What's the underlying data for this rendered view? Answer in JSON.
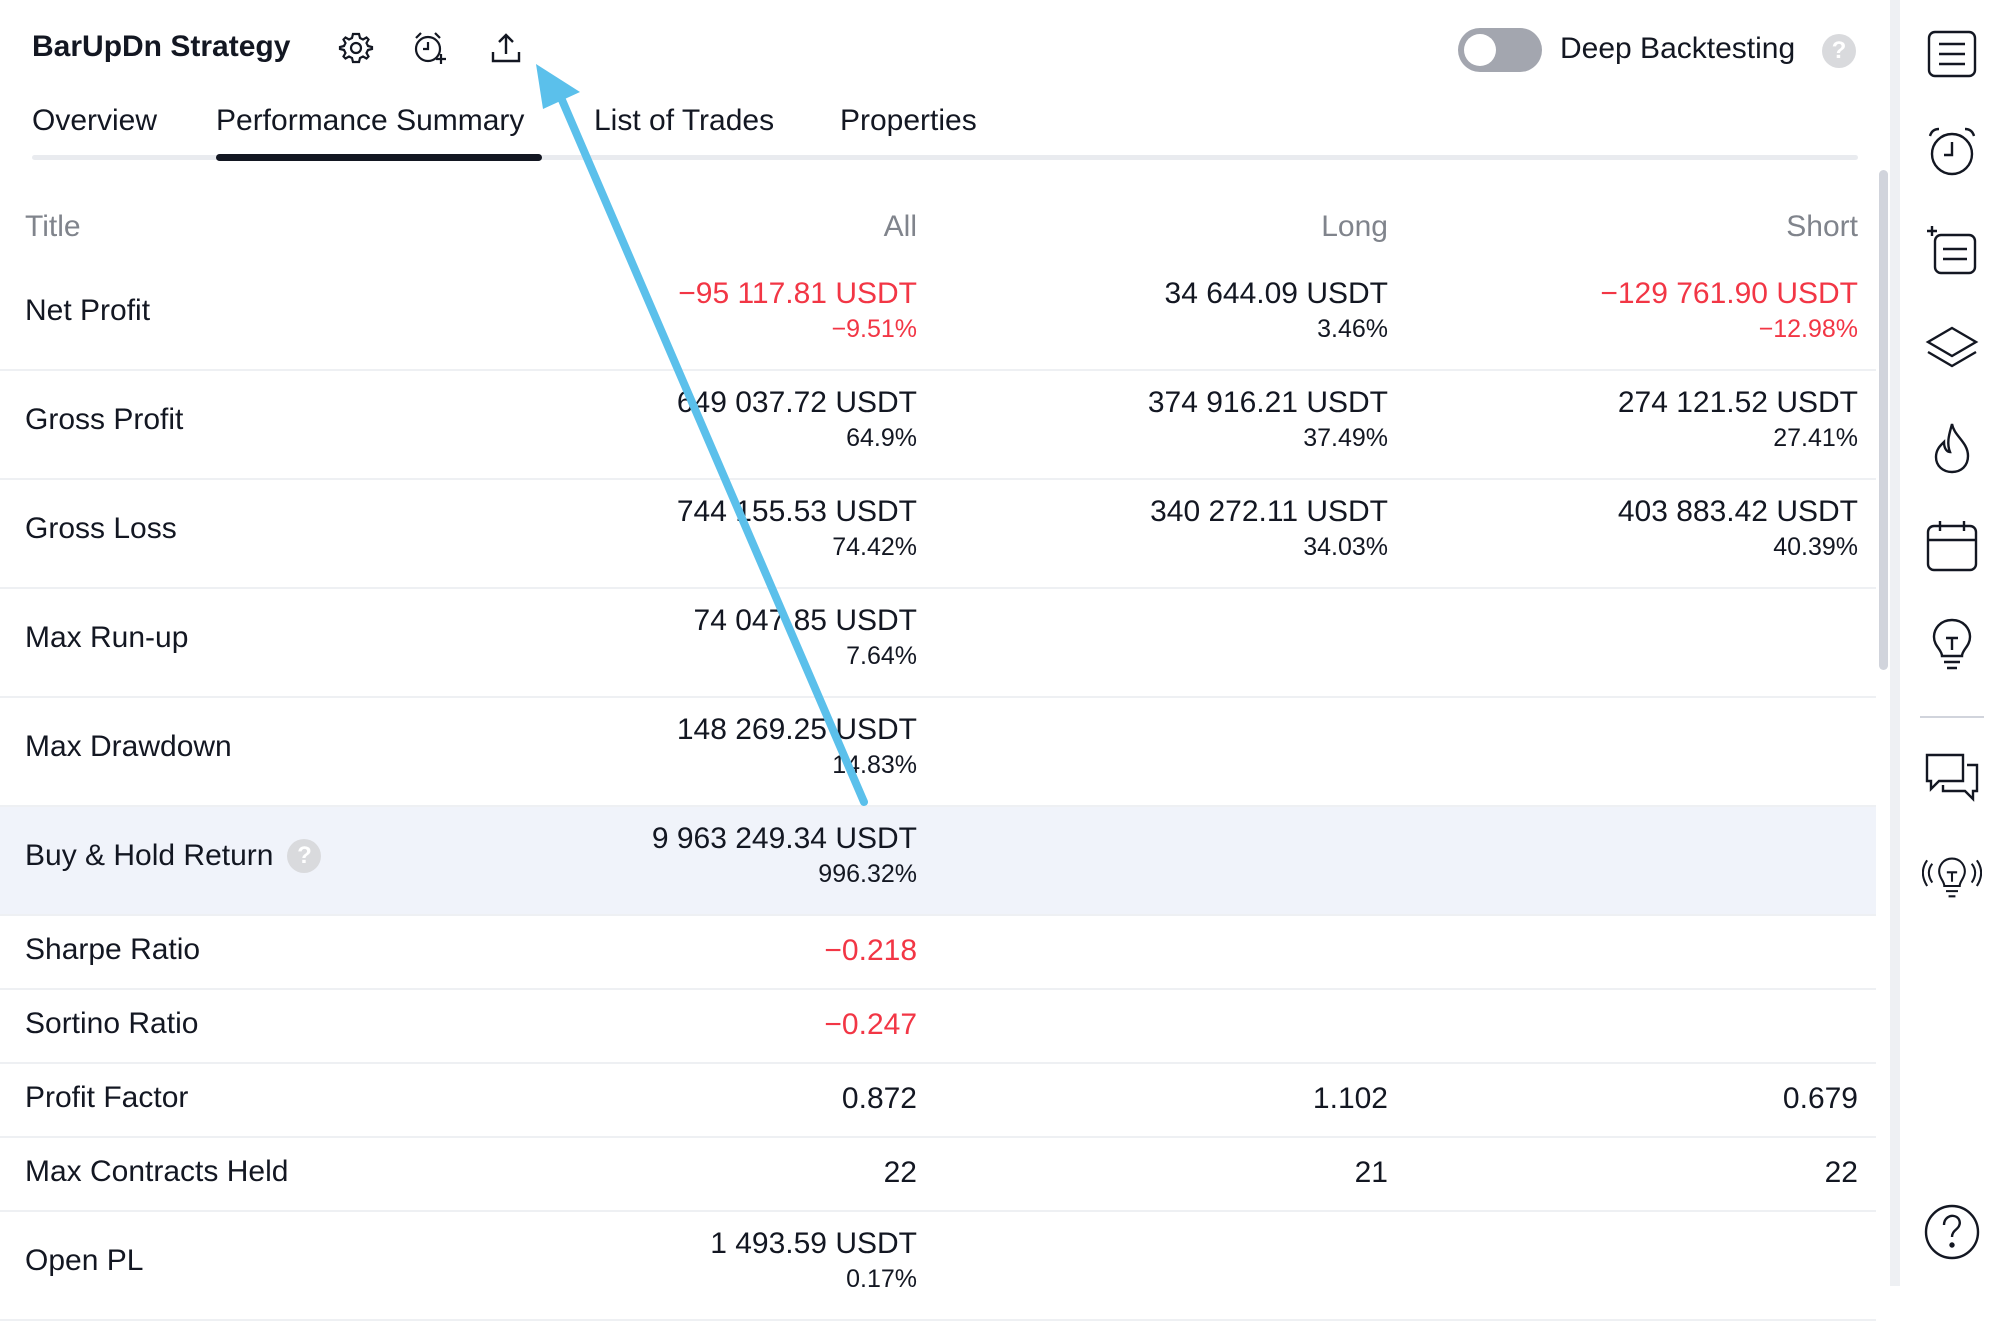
{
  "header": {
    "title": "BarUpDn Strategy",
    "icons": [
      "gear-icon",
      "add-alert-icon",
      "export-icon"
    ],
    "deep_backtesting_label": "Deep Backtesting",
    "deep_backtesting_on": false,
    "help_glyph": "?"
  },
  "tabs": [
    {
      "label": "Overview",
      "active": false
    },
    {
      "label": "Performance Summary",
      "active": true
    },
    {
      "label": "List of Trades",
      "active": false
    },
    {
      "label": "Properties",
      "active": false
    }
  ],
  "table": {
    "columns": [
      "Title",
      "All",
      "Long",
      "Short"
    ],
    "rows": [
      {
        "title": "Net Profit",
        "all": {
          "value": "−95 117.81 USDT",
          "pct": "−9.51%",
          "neg": true
        },
        "long": {
          "value": "34 644.09 USDT",
          "pct": "3.46%"
        },
        "short": {
          "value": "−129 761.90 USDT",
          "pct": "−12.98%",
          "neg": true
        }
      },
      {
        "title": "Gross Profit",
        "all": {
          "value": "649 037.72 USDT",
          "pct": "64.9%"
        },
        "long": {
          "value": "374 916.21 USDT",
          "pct": "37.49%"
        },
        "short": {
          "value": "274 121.52 USDT",
          "pct": "27.41%"
        }
      },
      {
        "title": "Gross Loss",
        "all": {
          "value": "744 155.53 USDT",
          "pct": "74.42%"
        },
        "long": {
          "value": "340 272.11 USDT",
          "pct": "34.03%"
        },
        "short": {
          "value": "403 883.42 USDT",
          "pct": "40.39%"
        }
      },
      {
        "title": "Max Run-up",
        "all": {
          "value": "74 047.85 USDT",
          "pct": "7.64%"
        }
      },
      {
        "title": "Max Drawdown",
        "all": {
          "value": "148 269.25 USDT",
          "pct": "14.83%"
        }
      },
      {
        "title": "Buy & Hold Return",
        "help": true,
        "highlight": true,
        "all": {
          "value": "9 963 249.34 USDT",
          "pct": "996.32%"
        }
      },
      {
        "title": "Sharpe Ratio",
        "all": {
          "value": "−0.218",
          "neg": true
        }
      },
      {
        "title": "Sortino Ratio",
        "all": {
          "value": "−0.247",
          "neg": true
        }
      },
      {
        "title": "Profit Factor",
        "all": {
          "value": "0.872"
        },
        "long": {
          "value": "1.102"
        },
        "short": {
          "value": "0.679"
        }
      },
      {
        "title": "Max Contracts Held",
        "all": {
          "value": "22"
        },
        "long": {
          "value": "21"
        },
        "short": {
          "value": "22"
        }
      },
      {
        "title": "Open PL",
        "all": {
          "value": "1 493.59 USDT",
          "pct": "0.17%"
        }
      }
    ]
  },
  "sidebar": {
    "icons": [
      "watchlist-icon",
      "alerts-icon",
      "object-tree-icon",
      "layers-icon",
      "hotlists-icon",
      "calendar-icon",
      "ideas-icon",
      "chats-icon",
      "ideas-stream-icon",
      "help-icon"
    ]
  },
  "colors": {
    "negative": "#f23645",
    "text": "#131722",
    "muted": "#80848c",
    "highlight_row": "#f0f3fa",
    "annotation_arrow": "#5bc0eb"
  }
}
